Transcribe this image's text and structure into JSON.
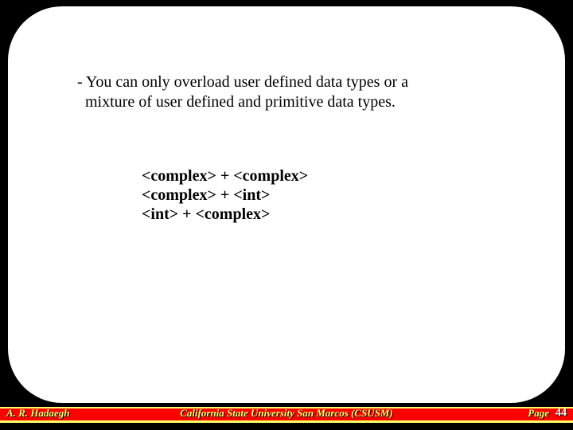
{
  "body": {
    "line1": "- You can only overload user defined data types or a",
    "line2": "  mixture of user defined and primitive data types."
  },
  "examples": {
    "l1": "<complex> + <complex>",
    "l2": "<complex> + <int>",
    "l3": "<int> + <complex>"
  },
  "footer": {
    "author": "A. R. Hadaegh",
    "university": "California State University San Marcos (CSUSM)",
    "page_label": "Page",
    "page_number": "44"
  }
}
